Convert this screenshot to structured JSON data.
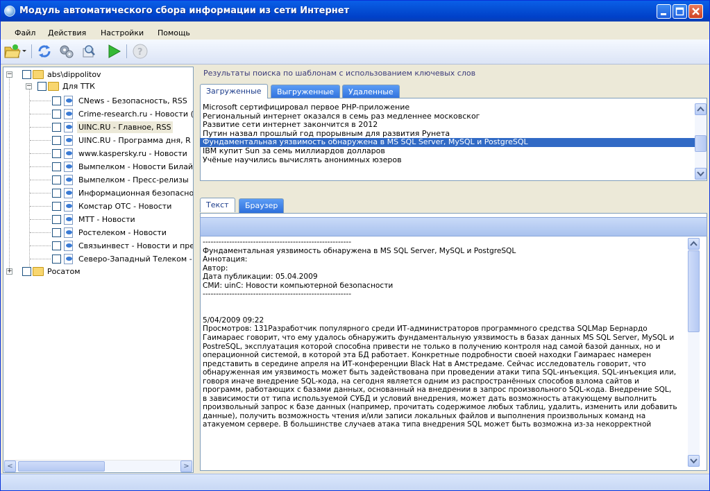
{
  "window": {
    "title": "Модуль автоматического сбора информации из сети Интернет"
  },
  "menu": [
    "Файл",
    "Действия",
    "Настройки",
    "Помощь"
  ],
  "toolbar": [
    "open-folder-icon",
    "refresh-icon",
    "settings-gears-icon",
    "search-tool-icon",
    "play-icon",
    "help-icon"
  ],
  "tree": {
    "root": "abs\\dippolitov",
    "group1": "Для ТТК",
    "items": [
      "CNews - Безопасность, RSS",
      "Crime-research.ru - Новости (з",
      "UINC.RU - Главное, RSS",
      "UINC.RU - Программа дня, R",
      "www.kaspersky.ru - Новости",
      "Вымпелком - Новости Билай",
      "Вымпелком - Пресс-релизы",
      "Информационная безопасно",
      "Комстар ОТС - Новости",
      "МТТ - Новости",
      "Ростелеком - Новости",
      "Связьинвест - Новости и пре",
      "Северо-Западный Телеком -"
    ],
    "group2": "Росатом",
    "scroll_left": "<",
    "scroll_right": ">"
  },
  "results": {
    "label": "Результаты поиска по шаблонам с использованием ключевых слов",
    "tabs": [
      "Загруженные",
      "Выгруженные",
      "Удаленные"
    ],
    "items": [
      "Microsoft сертифицировал первое PHP-приложение",
      "Региональный интернет оказался в семь раз медленнее московског",
      "Развитие сети интернет закончится в 2012",
      "Путин назвал прошлый год прорывным для развития Рунета",
      "Фундаментальная уязвимость обнаружена в MS SQL Server, MySQL и PostgreSQL",
      "IBM купит Sun за семь миллиардов долларов",
      "Учёные научились вычислять анонимных юзеров"
    ]
  },
  "detail": {
    "tabs": [
      "Текст",
      "Браузер"
    ],
    "lines": [
      "--------------------------------------------------------",
      "Фундаментальная уязвимость обнаружена в MS SQL Server, MySQL и PostgreSQL",
      "Аннотация:",
      "Автор:",
      "Дата публикации: 05.04.2009",
      "СМИ: uinC: Новости компьютерной безопасности",
      "--------------------------------------------------------",
      "",
      "",
      "5/04/2009 09:22",
      "Просмотров: 131Разработчик популярного среди ИТ-администраторов программного средства SQLMap Бернардо",
      "Гаимараес говорит, что ему удалось обнаружить фундаментальную уязвимость в базах данных MS SQL Server, MySQL и",
      "PostreSQL, эксплуатация которой способна привести не только в получению контроля над самой базой данных, но и",
      "операционной системой, в которой эта БД работает. Конкретные подробности своей находки Гаимараес намерен",
      "представить в середине апреля на ИТ-конференции Black Hat в Амстредаме. Сейчас исследователь говорит, что",
      "обнаруженная им уязвимость может быть задействована при проведении атаки типа SQL-инъекция. SQL-инъекция или,",
      "говоря иначе внедрение SQL-кода, на сегодня является одним из распространённых способов взлома сайтов и",
      "программ, работающих с базами данных, основанный на внедрении в запрос произвольного SQL-кода. Внедрение SQL,",
      "в зависимости от типа используемой СУБД и условий внедрения, может дать возможность атакующему выполнить",
      "произвольный запрос к базе данных (например, прочитать содержимое любых таблиц, удалить, изменить или добавить",
      "данные), получить возможность чтения и/или записи локальных файлов и выполнения произвольных команд на",
      "атакуемом сервере. В большинстве случаев атака типа внедрения SQL может быть возможна из-за некорректной"
    ]
  }
}
